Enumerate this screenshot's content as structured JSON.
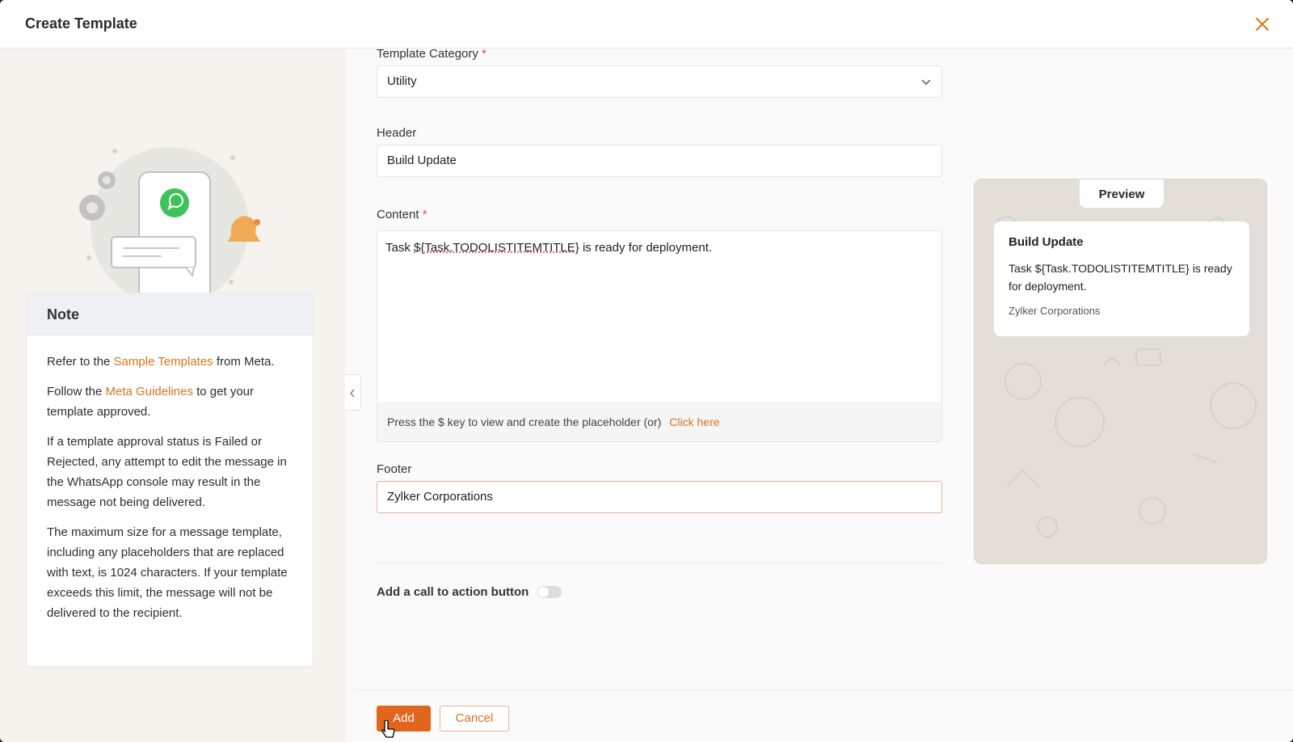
{
  "header": {
    "title": "Create Template"
  },
  "note": {
    "title": "Note",
    "p1_pre": "Refer to the ",
    "p1_link": "Sample Templates",
    "p1_post": " from Meta.",
    "p2_pre": "Follow the ",
    "p2_link": "Meta Guidelines",
    "p2_post": " to get your template approved.",
    "p3": "If a template approval status is Failed or Rejected, any attempt to edit the message in the WhatsApp console may result in the message not being delivered.",
    "p4": "The maximum size for a message template, including any placeholders that are replaced with text, is 1024 characters. If your template exceeds this limit, the message will not be delivered to the recipient."
  },
  "form": {
    "category_label": "Template Category",
    "category_value": "Utility",
    "header_label": "Header",
    "header_value": "Build Update",
    "content_label": "Content",
    "content_pre": "Task ",
    "content_placeholder": "${Task.TODOLISTITEMTITLE}",
    "content_post": " is ready for deployment.",
    "helper_text": "Press the $ key to view and create the placeholder (or)",
    "helper_link": "Click here",
    "footer_label": "Footer",
    "footer_value": "Zylker Corporations",
    "cta_label": "Add a call to action button",
    "required_mark": "*"
  },
  "preview": {
    "tab": "Preview",
    "header": "Build Update",
    "content": "Task ${Task.TODOLISTITEMTITLE} is ready for deployment.",
    "footer": "Zylker Corporations"
  },
  "actions": {
    "add": "Add",
    "cancel": "Cancel"
  },
  "colors": {
    "accent": "#e2651d",
    "link": "#d9731d",
    "whatsapp": "#3fc15a"
  }
}
